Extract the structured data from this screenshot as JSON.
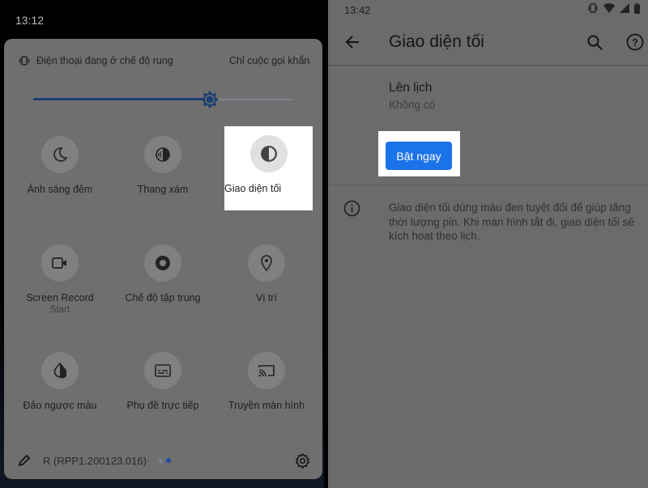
{
  "left": {
    "clock": "13:12",
    "vibrate_status": "Điện thoại đang ở chế độ rung",
    "dnd_status": "Chỉ cuộc gọi khẩn cấp",
    "brightness_percent": 68,
    "tiles": [
      {
        "label": "Ánh sáng đêm",
        "icon": "moon-icon"
      },
      {
        "label": "Thang xám",
        "icon": "grayscale-icon"
      },
      {
        "label": "Giao diện tối",
        "icon": "dark-theme-icon",
        "highlighted": true
      },
      {
        "label": "Screen Record",
        "sub": "Start",
        "icon": "screen-record-icon"
      },
      {
        "label": "Chế độ tập trung",
        "icon": "focus-icon"
      },
      {
        "label": "Vị trí",
        "icon": "location-icon"
      },
      {
        "label": "Đảo ngược màu",
        "icon": "invert-colors-icon"
      },
      {
        "label": "Phụ đề trực tiếp",
        "icon": "captions-icon"
      },
      {
        "label": "Truyền màn hình",
        "icon": "cast-icon"
      }
    ],
    "build": "R (RPP1.200123.016)",
    "page_dots": {
      "count": 2,
      "active": 2
    }
  },
  "right": {
    "clock": "13:42",
    "title": "Giao diện tối",
    "schedule_label": "Lên lịch",
    "schedule_value": "Không có",
    "button": "Bật ngay",
    "info": "Giao diện tối dùng màu đen tuyệt đối để giúp tăng thời lượng pin. Khi màn hình tắt đi, giao diện tối sẽ kích hoạt theo lịch."
  },
  "colors": {
    "accent": "#1a73e8",
    "highlight": "#ffffff"
  }
}
